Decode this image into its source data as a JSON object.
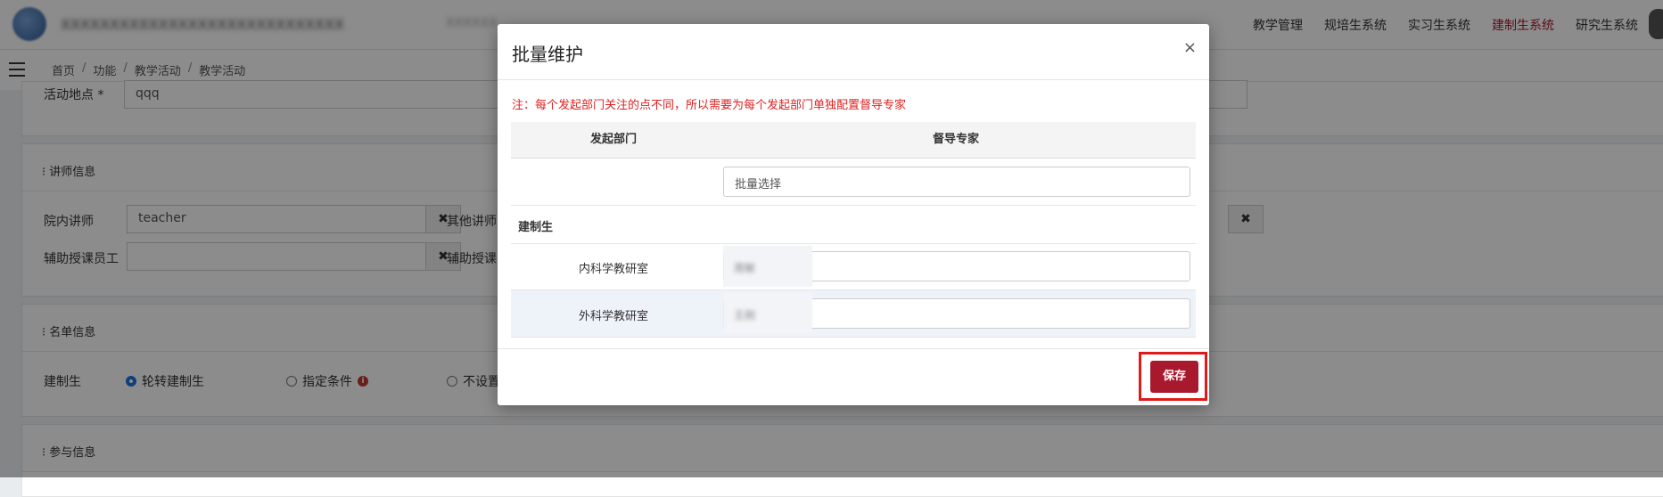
{
  "topnav": [
    "教学管理",
    "规培生系统",
    "实习生系统",
    "建制生系统",
    "研究生系统"
  ],
  "colors": {
    "accent": "#a8192e",
    "note": "#e02020",
    "highlight": "#e01919"
  },
  "breadcrumb": [
    "首页",
    "功能",
    "教学活动",
    "教学活动"
  ],
  "form": {
    "location_label": "活动地点 *",
    "location_value": "qqq",
    "lecturer_section": "⁝ 讲师信息",
    "inner_lecturer_label": "院内讲师",
    "inner_lecturer_value": "teacher",
    "other_lecturer_label": "其他讲师",
    "assistant_label": "辅助授课员工",
    "assistant2_label": "辅助授课",
    "roster_section": "⁝ 名单信息",
    "trainee_label": "建制生",
    "radio_rotation": "轮转建制生",
    "radio_condition": "指定条件",
    "radio_none": "不设置",
    "participate_section": "⁝ 参与信息"
  },
  "modal": {
    "title": "批量维护",
    "close": "×",
    "note": "注：每个发起部门关注的点不同，所以需要为每个发起部门单独配置督导专家",
    "col_dept": "发起部门",
    "col_expert": "督导专家",
    "batch_placeholder": "批量选择",
    "group_label": "建制生",
    "rows": [
      {
        "dept": "内科学教研室",
        "expert": "周敏"
      },
      {
        "dept": "外科学教研室",
        "expert": "王刚"
      }
    ],
    "save": "保存"
  }
}
